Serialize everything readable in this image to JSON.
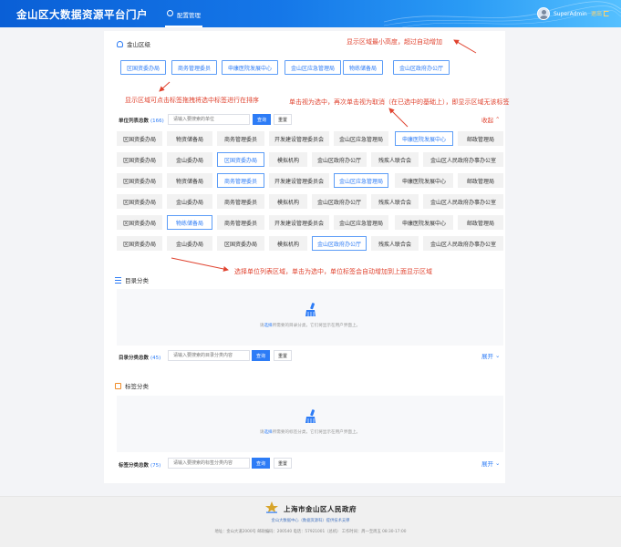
{
  "header": {
    "title": "金山区大数据资源平台门户",
    "nav_tab": "配置管理",
    "username": "SuperAdmin",
    "logout": "退出"
  },
  "section_jurisdiction": {
    "title": "金山区级"
  },
  "selected_tags": [
    "区国资委办局",
    "商务管理委员",
    "申康医院发展中心",
    "金山区应急管理局",
    "物练储备局",
    "金山区政府办公厅"
  ],
  "unit_filter": {
    "label": "单位列表总数",
    "count": "(166)",
    "placeholder": "请输入要搜索的单位",
    "query": "查询",
    "reset": "重置",
    "toggle": "收起"
  },
  "unit_rows": [
    [
      "区国资委办局",
      "物资储备局",
      "商务管理委员",
      "开发建设管理委员会",
      "金山区应急管理局",
      "申康医院发展中心",
      "邮政管理局"
    ],
    [
      "区国资委办局",
      "金山委办局",
      "区国资委办局",
      "模拟机构",
      "金山区政府办公厅",
      "残疾人联合会",
      "金山区人民政府办事办公室"
    ],
    [
      "区国资委办局",
      "物资储备局",
      "商务管理委员",
      "开发建设管理委员会",
      "金山区应急管理局",
      "申康医院发展中心",
      "邮政管理局"
    ],
    [
      "区国资委办局",
      "金山委办局",
      "商务管理委员",
      "模拟机构",
      "金山区政府办公厅",
      "残疾人联合会",
      "金山区人民政府办事办公室"
    ],
    [
      "区国资委办局",
      "物练储备局",
      "商务管理委员",
      "开发建设管理委员会",
      "金山区应急管理局",
      "申康医院发展中心",
      "邮政管理局"
    ],
    [
      "区国资委办局",
      "金山委办局",
      "区国资委办局",
      "模拟机构",
      "金山区政府办公厅",
      "残疾人联合会",
      "金山区人民政府办事办公室"
    ]
  ],
  "section_catalog": {
    "title": "目录分类",
    "empty_pre": "请",
    "empty_link": "选择",
    "empty_post": "所需要的目录分类，它们将显示在用户界面上。",
    "filter_label": "目录分类总数",
    "count": "(45)",
    "placeholder": "请输入要搜索的目录分类内容",
    "query": "查询",
    "reset": "重置",
    "toggle": "展开"
  },
  "section_tags": {
    "title": "标签分类",
    "empty_pre": "请",
    "empty_link": "选择",
    "empty_post": "所需要的标签分类，它们将显示在用户界面上。",
    "filter_label": "标签分类总数",
    "count": "(75)",
    "placeholder": "请输入要搜索的标签分类内容",
    "query": "查询",
    "reset": "重置",
    "toggle": "展开"
  },
  "annotations": {
    "a1": "显示区域最小高度，超过自动增加",
    "a2": "显示区域可点击标签拖拽将选中标签进行在排序",
    "a3": "单击视为选中，再次单击视为取消（在已选中的基础上），即显示区域无该标签",
    "a4": "选择单位列表区域，单击为选中，单位标签会自动增加到上面显示区域"
  },
  "footer": {
    "title": "上海市金山区人民政府",
    "sub": "金山大数据中心（数据资源科）提供技术支撑",
    "info": "地址：金山大道2000号    邮政编码：200540    电话：57921001（总机）    工作时间：周一至周五 08:30-17:00"
  },
  "colors": {
    "primary": "#2d7cf6",
    "annotation": "#e0432f",
    "header_start": "#0a5fd6",
    "header_end": "#55c0ff"
  }
}
